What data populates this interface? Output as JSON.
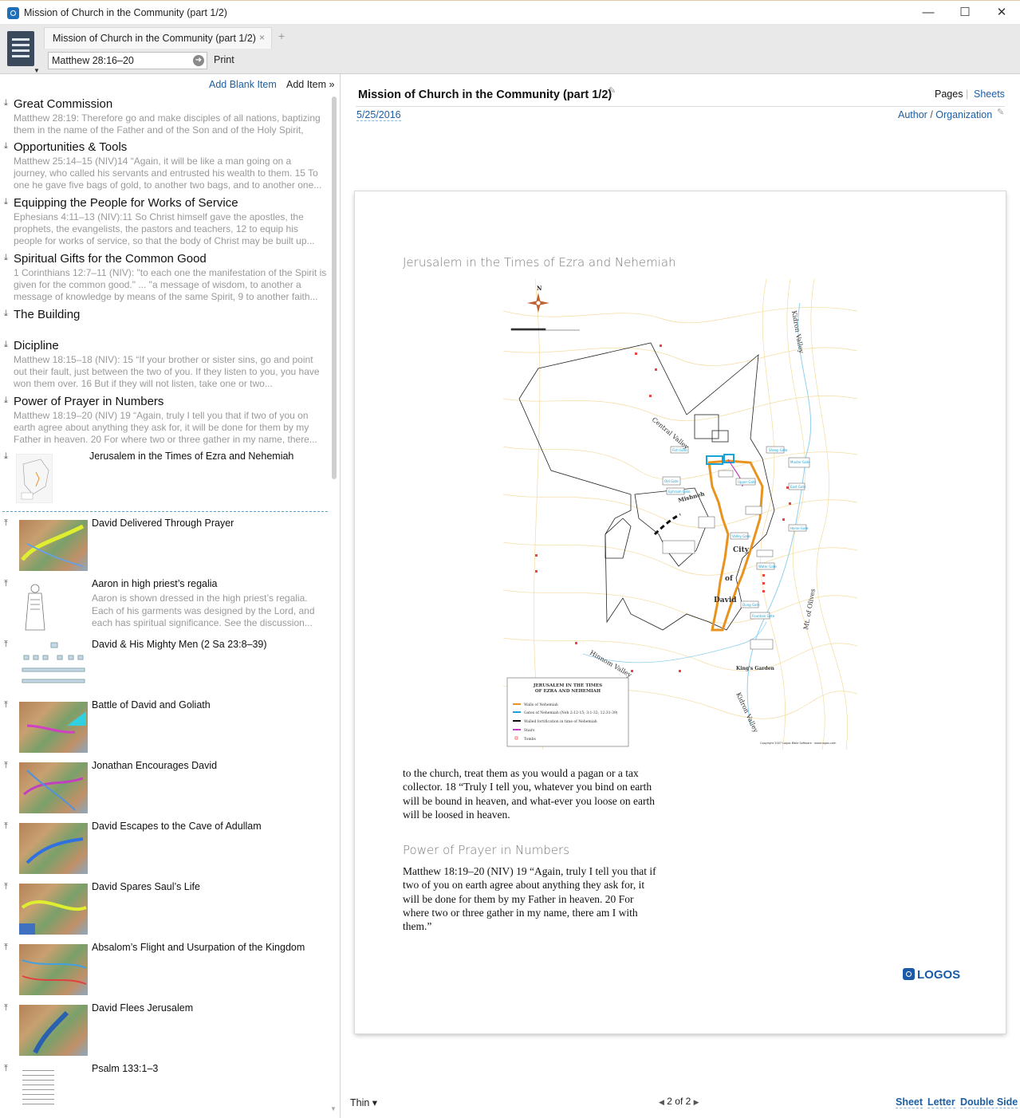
{
  "window": {
    "title": "Mission of Church in the Community (part 1/2)"
  },
  "tab": {
    "label": "Mission of Church in the Community (part 1/2)",
    "close": "×",
    "add": "+"
  },
  "toolbar": {
    "reference": "Matthew 28:16–20",
    "print": "Print"
  },
  "left_panel": {
    "add_blank": "Add Blank Item",
    "add_item": "Add Item »",
    "items": [
      {
        "title": "Great Commission",
        "body": "Matthew 28:19: Therefore go and make disciples of all nations, baptizing them in the name of the Father and of the Son and of the Holy Spirit,"
      },
      {
        "title": "Opportunities & Tools",
        "body": "Matthew 25:14–15 (NIV)14 “Again, it will be like a man going on a journey, who called his servants and entrusted his wealth to them. 15 To one he gave five bags of gold, to another two bags, and to another one..."
      },
      {
        "title": "Equipping the People for Works of Service",
        "body": "Ephesians 4:11–13 (NIV):11 So Christ himself gave the apostles, the prophets, the evangelists, the pastors and teachers, 12 to equip his people for works of service, so that the body of Christ may be built up..."
      },
      {
        "title": "Spiritual Gifts for the Common Good",
        "body": "1 Corinthians 12:7–11 (NIV): \"to each one the manifestation of the Spirit is given for the common good.\" ... \"a message of wisdom, to another a message of knowledge by means of the same Spirit, 9 to another faith..."
      },
      {
        "title": "The Building",
        "body": ""
      },
      {
        "title": "Dicipline",
        "body": "Matthew 18:15–18 (NIV): 15 “If your brother or sister sins, go and point out their fault, just between the two of you. If they listen to you, you have won them over. 16 But if they will not listen, take one or two..."
      },
      {
        "title": "Power of Prayer in Numbers",
        "body": "Matthew 18:19–20 (NIV) 19 “Again, truly I tell you that if two of you on earth agree about anything they ask for, it will be done for them by my Father in heaven. 20 For where two or three gather in my name, there..."
      }
    ],
    "map_item": {
      "title": "Jerusalem in the Times of Ezra and Nehemiah"
    },
    "media": [
      {
        "title": "David Delivered Through Prayer",
        "body": ""
      },
      {
        "title": "Aaron in high priest’s regalia",
        "body": "Aaron is shown dressed in the high priest’s regalia. Each of his garments was designed by the Lord, and each has spiritual significance. See the discussion..."
      },
      {
        "title": "David & His Mighty Men (2 Sa 23:8–39)",
        "body": ""
      },
      {
        "title": "Battle of David and Goliath",
        "body": ""
      },
      {
        "title": "Jonathan Encourages David",
        "body": ""
      },
      {
        "title": "David Escapes to the Cave of Adullam",
        "body": ""
      },
      {
        "title": "David Spares Saul’s Life",
        "body": ""
      },
      {
        "title": "Absalom’s Flight and Usurpation of the Kingdom",
        "body": ""
      },
      {
        "title": "David Flees Jerusalem",
        "body": ""
      },
      {
        "title": "Psalm 133:1–3",
        "body": ""
      }
    ]
  },
  "document": {
    "title": "Mission of Church in the Community (part 1/2)",
    "pages": "Pages",
    "sep": "|",
    "sheets": "Sheets",
    "date": "5/25/2016",
    "author": "Author",
    "slash": " / ",
    "organization": "Organization",
    "map_heading": "Jerusalem in the Times of Ezra and Nehemiah",
    "text1": "to the church, treat them as you would a pagan or a tax collector. 18 “Truly I tell you, whatever you bind on earth will be bound in heaven, and what-ever you loose on earth will be loosed in heaven.",
    "sub_heading": "Power of Prayer in Numbers",
    "text2": "Matthew 18:19–20 (NIV) 19 “Again, truly I tell you that if two of you on earth agree about anything they ask for, it will be done for them by my Father in heaven. 20 For where two or three gather in my name, there am I with them.”",
    "logo": "LOGOS"
  },
  "map": {
    "north": "N",
    "legend_title1": "JERUSALEM IN THE TIMES",
    "legend_title2": "OF EZRA AND NEHEMIAH",
    "legend": [
      "Walls of Nehemiah",
      "Gates of Nehemiah (Neh 2:12-15; 3:1-32; 12:31-39)",
      "Walled fortification in time of Nehemiah",
      "Stairs",
      "Tombs"
    ],
    "labels": [
      "Kidron Valley",
      "Central Valley",
      "Mishneh",
      "City",
      "of",
      "David",
      "Hinnom Valley",
      "Mt. of Olives",
      "King's Garden",
      "Kidron Valley"
    ],
    "gates": [
      "Fish Gate",
      "Sheep Gate",
      "Muster Gate",
      "East Gate",
      "Horse Gate",
      "Water Gate",
      "Dung Gate",
      "Fountain Gate",
      "Valley Gate",
      "Old Gate",
      "Ephraim Gate",
      "Upper Gate"
    ],
    "copyright": "Copyright 2007 Logos Bible Software · www.logos.com"
  },
  "footer": {
    "thin": "Thin ▾",
    "pager": "2 of 2",
    "sheet": "Sheet",
    "letter": "Letter",
    "double": "Double Side"
  },
  "colors": {
    "link": "#1d5fa3",
    "wall": "#e8931e",
    "gate": "#1aa3d6"
  }
}
